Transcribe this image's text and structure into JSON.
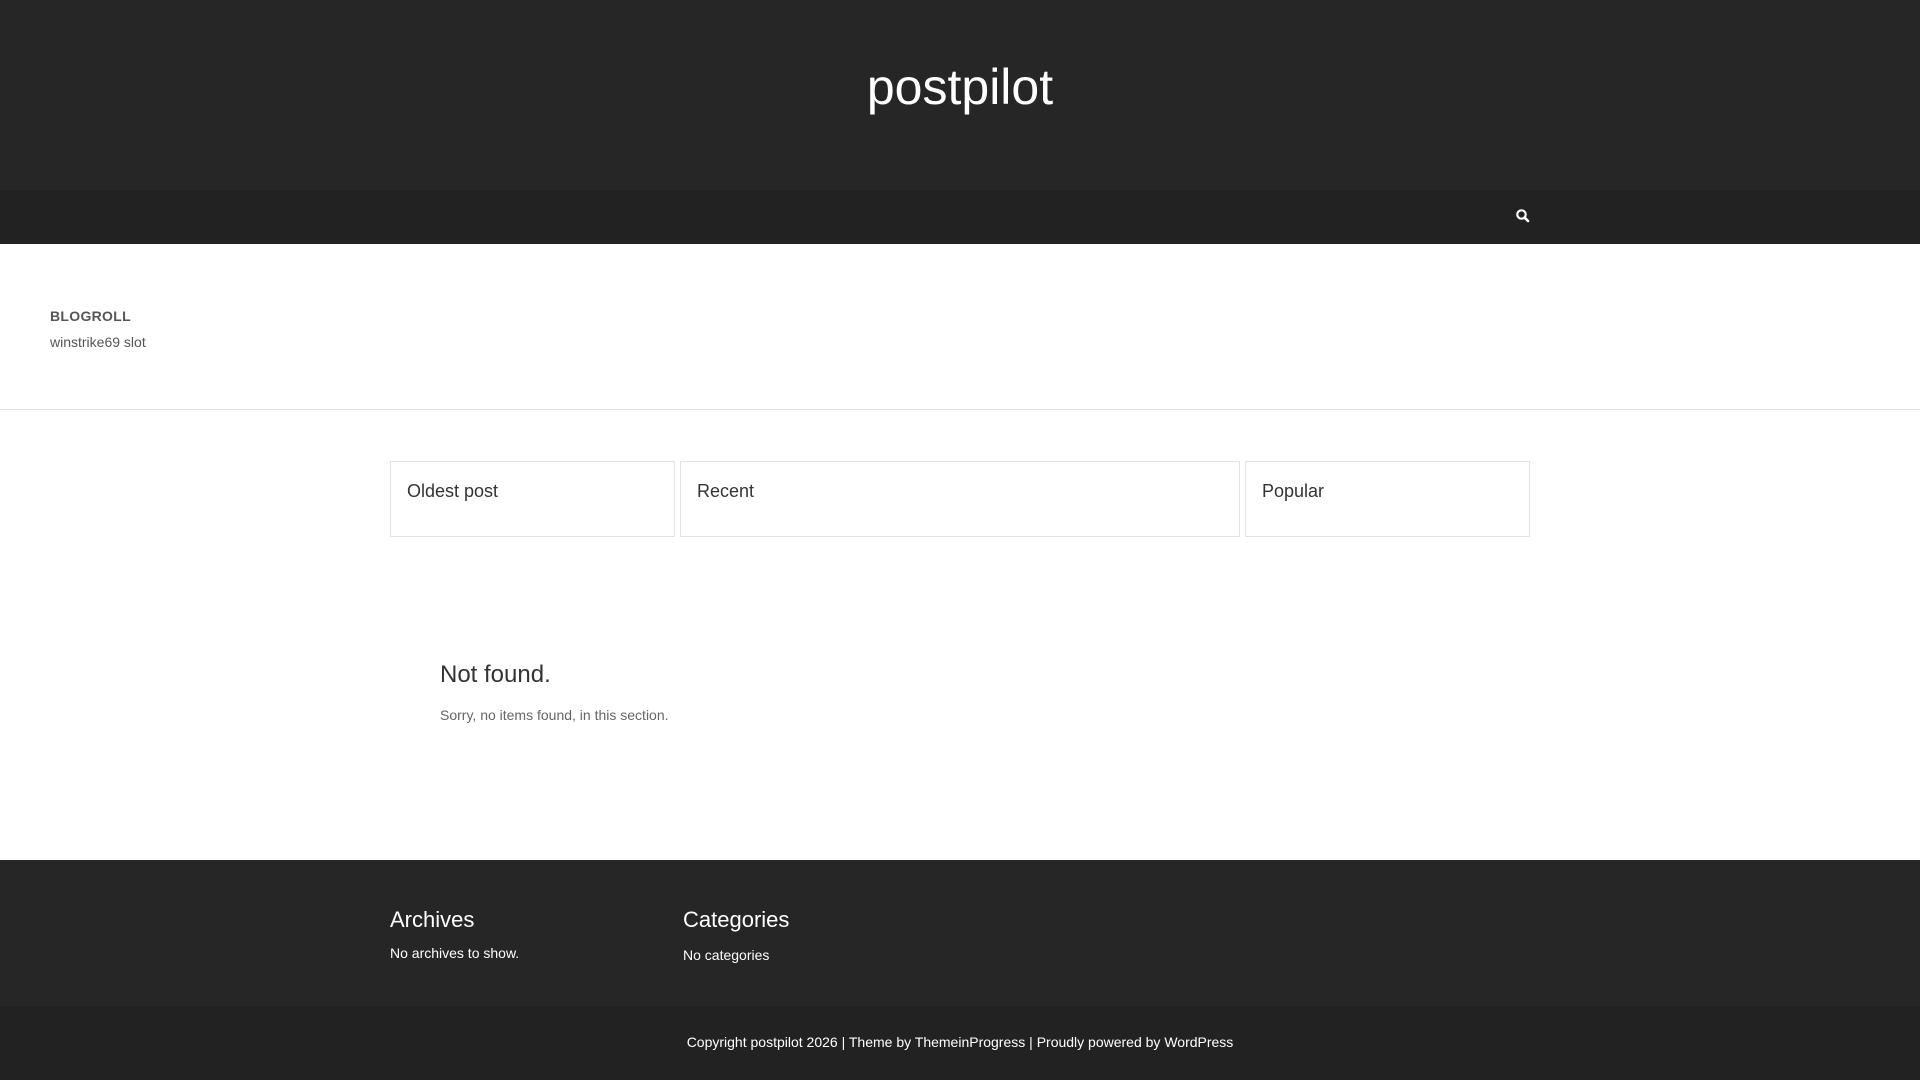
{
  "header": {
    "site_title": "postpilot",
    "search_icon": "search-icon"
  },
  "blogroll": {
    "title": "BLOGROLL",
    "links": [
      "winstrike69 slot"
    ]
  },
  "tabs": [
    {
      "label": "Oldest post"
    },
    {
      "label": "Recent"
    },
    {
      "label": "Popular"
    }
  ],
  "main": {
    "heading": "Not found.",
    "message": "Sorry, no items found, in this section."
  },
  "footer": {
    "archives": {
      "title": "Archives",
      "text": "No archives to show."
    },
    "categories": {
      "title": "Categories",
      "text": "No categories"
    },
    "copyright_prefix": "Copyright",
    "copyright_site": "postpilot",
    "copyright_year": "2026",
    "separator1": "|",
    "theme_by": "Theme by",
    "theme_author": "ThemeinProgress",
    "separator2": "|",
    "powered_by": "Proudly powered by",
    "wordpress": "WordPress"
  },
  "colors": {
    "header_bg": "#262626",
    "nav_bg": "#222222",
    "footer_bg": "#262626",
    "bottom_bg": "#222222"
  }
}
